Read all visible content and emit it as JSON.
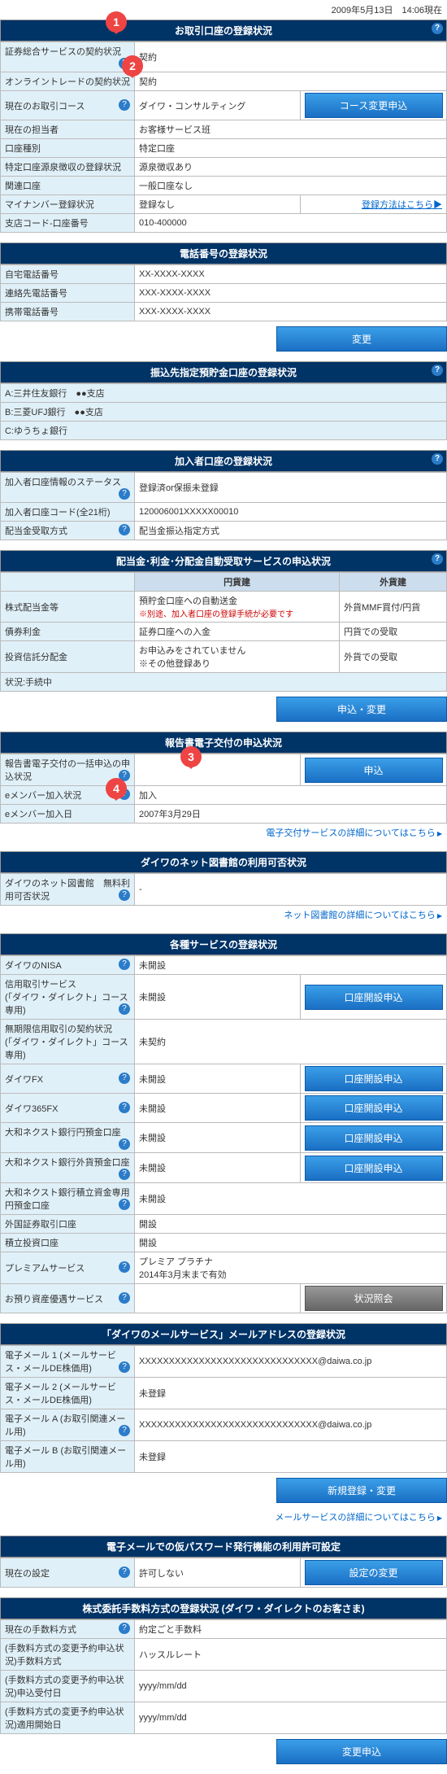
{
  "timestamp": "2009年5月13日　14:06現在",
  "account": {
    "header": "お取引口座の登録状況",
    "rows": {
      "sec_service": {
        "label": "証券総合サービスの契約状況",
        "value": "契約"
      },
      "online_trade": {
        "label": "オンライントレードの契約状況",
        "value": "契約"
      },
      "course": {
        "label": "現在のお取引コース",
        "value": "ダイワ・コンサルティング",
        "btn": "コース変更申込"
      },
      "staff": {
        "label": "現在の担当者",
        "value": "お客様サービス班"
      },
      "type": {
        "label": "口座種別",
        "value": "特定口座"
      },
      "withholding": {
        "label": "特定口座源泉徴収の登録状況",
        "value": "源泉徴収あり"
      },
      "related": {
        "label": "関連口座",
        "value": "一般口座なし"
      },
      "mynumber": {
        "label": "マイナンバー登録状況",
        "value": "登録なし",
        "link": "登録方法はこちら"
      },
      "branch": {
        "label": "支店コード-口座番号",
        "value": "010-400000"
      }
    }
  },
  "phone": {
    "header": "電話番号の登録状況",
    "home": {
      "label": "自宅電話番号",
      "value": "XX-XXXX-XXXX"
    },
    "contact": {
      "label": "連絡先電話番号",
      "value": "XXX-XXXX-XXXX"
    },
    "mobile": {
      "label": "携帯電話番号",
      "value": "XXX-XXXX-XXXX"
    },
    "btn": "変更"
  },
  "transfer": {
    "header": "振込先指定預貯金口座の登録状況",
    "a": {
      "label": "A:三井住友銀行　●●支店"
    },
    "b": {
      "label": "B:三菱UFJ銀行　●●支店"
    },
    "c": {
      "label": "C:ゆうちょ銀行"
    }
  },
  "subscriber": {
    "header": "加入者口座の登録状況",
    "status": {
      "label": "加入者口座情報のステータス",
      "value": "登録済or保振未登録"
    },
    "code": {
      "label": "加入者口座コード(全21桁)",
      "value": "120006001XXXXX00010"
    },
    "dividend": {
      "label": "配当金受取方式",
      "value": "配当金振込指定方式"
    }
  },
  "dividend_service": {
    "header": "配当金･利金･分配金自動受取サービスの申込状況",
    "col1": "円貨建",
    "col2": "外貨建",
    "stock": {
      "label": "株式配当金等",
      "v1": "預貯金口座への自動送金",
      "v1note": "※別途、加入者口座の登録手続が必要です",
      "v2": "外貨MMF買付/円貨"
    },
    "bond": {
      "label": "債券利金",
      "v1": "証券口座への入金",
      "v2": "円貨での受取"
    },
    "trust": {
      "label": "投資信託分配金",
      "v1": "お申込みをされていません",
      "v1b": "※その他登録あり",
      "v2": "外貨での受取"
    },
    "status": {
      "label": "状況:手続中"
    },
    "btn": "申込・変更"
  },
  "edelivery": {
    "header": "報告書電子交付の申込状況",
    "batch": {
      "label": "報告書電子交付の一括申込の申込状況",
      "btn": "申込"
    },
    "emember": {
      "label": "eメンバー加入状況",
      "value": "加入"
    },
    "date": {
      "label": "eメンバー加入日",
      "value": "2007年3月29日"
    },
    "link": "電子交付サービスの詳細についてはこちら"
  },
  "library": {
    "header": "ダイワのネット図書館の利用可否状況",
    "row": {
      "label": "ダイワのネット図書館　無料利用可否状況",
      "value": "-"
    },
    "link": "ネット図書館の詳細についてはこちら"
  },
  "services": {
    "header": "各種サービスの登録状況",
    "nisa": {
      "label": "ダイワのNISA",
      "value": "未開設"
    },
    "credit": {
      "label": "信用取引サービス\n(「ダイワ・ダイレクト」コース専用)",
      "value": "未開設",
      "btn": "口座開設申込"
    },
    "unlimited": {
      "label": "無期限信用取引の契約状況\n(「ダイワ・ダイレクト」コース専用)",
      "value": "未契約"
    },
    "fx": {
      "label": "ダイワFX",
      "value": "未開設",
      "btn": "口座開設申込"
    },
    "fx365": {
      "label": "ダイワ365FX",
      "value": "未開設",
      "btn": "口座開設申込"
    },
    "next_yen": {
      "label": "大和ネクスト銀行円預金口座",
      "value": "未開設",
      "btn": "口座開設申込"
    },
    "next_fc": {
      "label": "大和ネクスト銀行外貨預金口座",
      "value": "未開設",
      "btn": "口座開設申込"
    },
    "next_reserve": {
      "label": "大和ネクスト銀行積立資金専用円預金口座",
      "value": "未開設"
    },
    "foreign": {
      "label": "外国証券取引口座",
      "value": "開設"
    },
    "reserve": {
      "label": "積立投資口座",
      "value": "開設"
    },
    "premium": {
      "label": "プレミアムサービス",
      "value": "プレミア プラチナ\n2014年3月末まで有効"
    },
    "asset": {
      "label": "お預り資産優遇サービス",
      "btn": "状況照会"
    }
  },
  "mail": {
    "header": "「ダイワのメールサービス」メールアドレスの登録状況",
    "m1": {
      "label": "電子メール 1 (メールサービス・メールDE株価用)",
      "value": "XXXXXXXXXXXXXXXXXXXXXXXXXXXXXX@daiwa.co.jp"
    },
    "m2": {
      "label": "電子メール 2 (メールサービス・メールDE株価用)",
      "value": "未登録"
    },
    "ma": {
      "label": "電子メール A (お取引関連メール用)",
      "value": "XXXXXXXXXXXXXXXXXXXXXXXXXXXXXX@daiwa.co.jp"
    },
    "mb": {
      "label": "電子メール B (お取引関連メール用)",
      "value": "未登録"
    },
    "btn": "新規登録・変更",
    "link": "メールサービスの詳細についてはこちら"
  },
  "password": {
    "header": "電子メールでの仮パスワード発行機能の利用許可設定",
    "row": {
      "label": "現在の設定",
      "value": "許可しない",
      "btn": "設定の変更"
    }
  },
  "commission": {
    "header": "株式委託手数料方式の登録状況 (ダイワ・ダイレクトのお客さま)",
    "current": {
      "label": "現在の手数料方式",
      "value": "約定ごと手数料"
    },
    "applied": {
      "label": "(手数料方式の変更予約申込状況)手数料方式",
      "value": "ハッスルレート"
    },
    "applydate": {
      "label": "(手数料方式の変更予約申込状況)申込受付日",
      "value": "yyyy/mm/dd"
    },
    "startdate": {
      "label": "(手数料方式の変更予約申込状況)適用開始日",
      "value": "yyyy/mm/dd"
    },
    "btn": "変更申込"
  },
  "callouts": {
    "c1": "1",
    "c2": "2",
    "c3": "3",
    "c4": "4"
  }
}
